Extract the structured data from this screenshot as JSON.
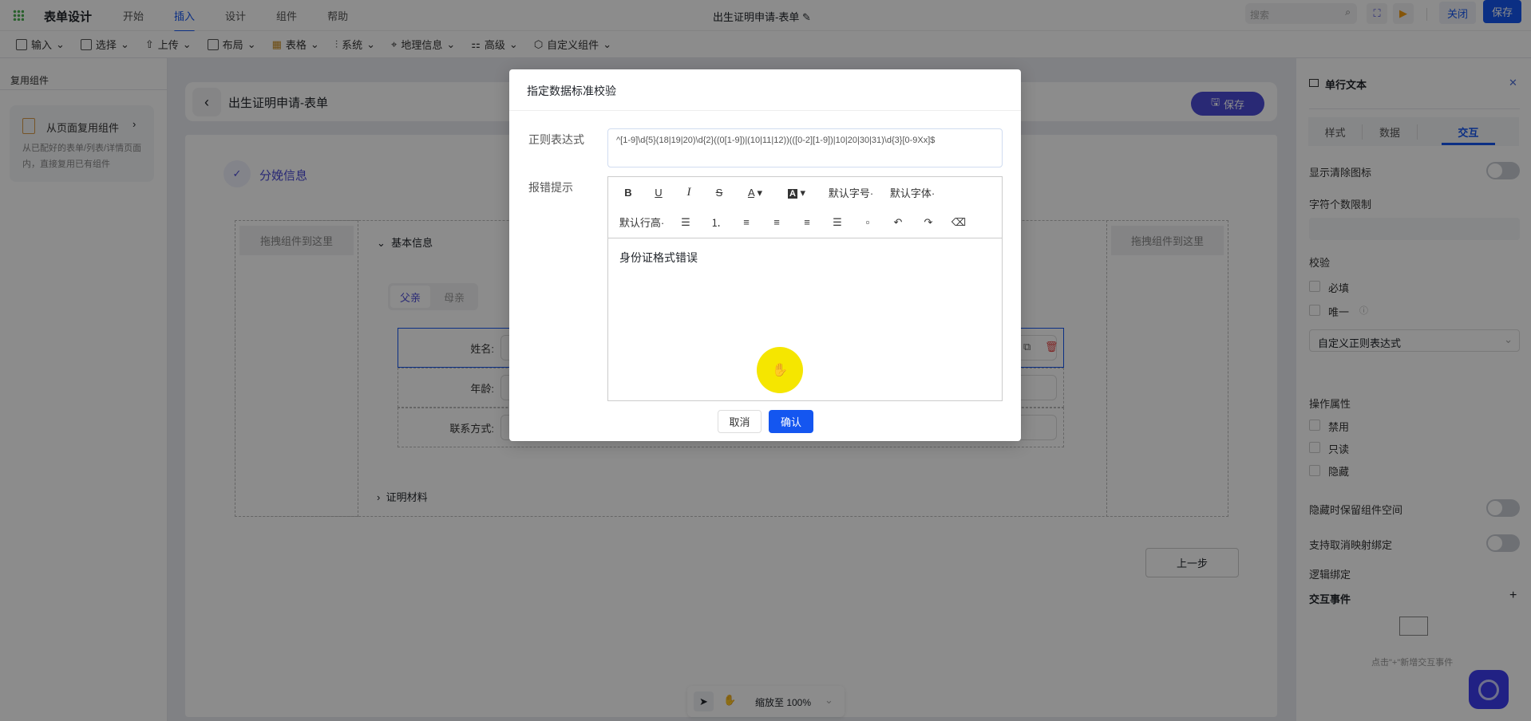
{
  "topbar": {
    "app_title": "表单设计",
    "nav": [
      "开始",
      "插入",
      "设计",
      "组件",
      "帮助"
    ],
    "doc_title": "出生证明申请-表单",
    "search_placeholder": "搜索",
    "close": "关闭",
    "save": "保存"
  },
  "toolbar": [
    "输入",
    "选择",
    "上传",
    "布局",
    "表格",
    "系统",
    "地理信息",
    "高级",
    "自定义组件"
  ],
  "left": {
    "title": "复用组件",
    "card_title": "从页面复用组件",
    "card_desc": "从已配好的表单/列表/详情页面内，直接复用已有组件"
  },
  "canvas": {
    "title": "出生证明申请-表单",
    "save": "保存",
    "step": "分娩信息",
    "drop": "拖拽组件到这里",
    "section1": "基本信息",
    "tabs": [
      "父亲",
      "母亲"
    ],
    "fields": [
      "姓名:",
      "年龄:",
      "联系方式:"
    ],
    "section2": "证明材料",
    "prev": "上一步",
    "zoom": "缩放至 100%"
  },
  "right": {
    "title": "单行文本",
    "tabs": [
      "样式",
      "数据",
      "交互"
    ],
    "show_clear": "显示清除图标",
    "char_limit": "字符个数限制",
    "validate": "校验",
    "required": "必填",
    "unique": "唯一",
    "regex_select": "自定义正则表达式",
    "op_attr": "操作属性",
    "disabled": "禁用",
    "readonly": "只读",
    "hidden": "隐藏",
    "keep_space": "隐藏时保留组件空间",
    "unmap": "支持取消映射绑定",
    "logic": "逻辑绑定",
    "events": "交互事件",
    "events_hint": "点击\"+\"新增交互事件"
  },
  "modal": {
    "title": "指定数据标准校验",
    "regex_label": "正则表达式",
    "regex_value": "^[1-9]\\d{5}(18|19|20)\\d{2}((0[1-9])|(10|11|12))(([0-2][1-9])|10|20|30|31)\\d{3}[0-9Xx]$",
    "error_label": "报错提示",
    "font_size": "默认字号",
    "font_family": "默认字体",
    "line_height": "默认行高",
    "content": "身份证格式错误",
    "cancel": "取消",
    "confirm": "确认"
  },
  "colors": {
    "primary": "#1456f0",
    "accent": "#4b4bd6"
  }
}
